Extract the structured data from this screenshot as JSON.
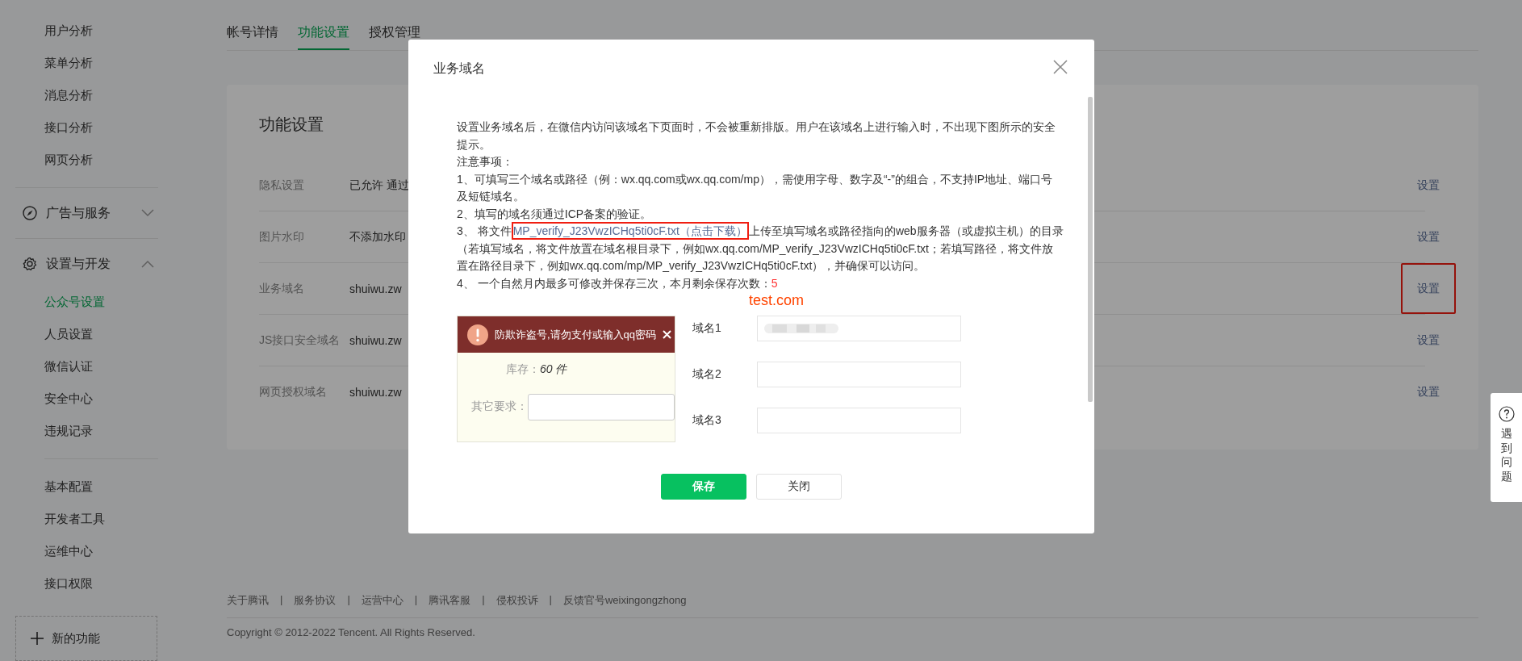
{
  "sidebar": {
    "groups": [
      {
        "kind": "plain",
        "items": [
          {
            "label": "用户分析",
            "selected": false
          },
          {
            "label": "菜单分析",
            "selected": false
          },
          {
            "label": "消息分析",
            "selected": false
          },
          {
            "label": "接口分析",
            "selected": false
          },
          {
            "label": "网页分析",
            "selected": false
          }
        ]
      },
      {
        "kind": "section",
        "label": "广告与服务",
        "expanded": false
      },
      {
        "kind": "section",
        "label": "设置与开发",
        "expanded": true,
        "items": [
          {
            "label": "公众号设置",
            "selected": true
          },
          {
            "label": "人员设置",
            "selected": false
          },
          {
            "label": "微信认证",
            "selected": false
          },
          {
            "label": "安全中心",
            "selected": false
          },
          {
            "label": "违规记录",
            "selected": false
          }
        ]
      },
      {
        "kind": "plain",
        "items": [
          {
            "label": "基本配置",
            "selected": false
          },
          {
            "label": "开发者工具",
            "selected": false
          },
          {
            "label": "运维中心",
            "selected": false
          },
          {
            "label": "接口权限",
            "selected": false
          }
        ]
      }
    ],
    "new_feature": "新的功能"
  },
  "tabs": [
    {
      "label": "帐号详情",
      "selected": false
    },
    {
      "label": "功能设置",
      "selected": true
    },
    {
      "label": "授权管理",
      "selected": false
    }
  ],
  "settings": {
    "title": "功能设置",
    "rows": [
      {
        "label": "隐私设置",
        "value": "已允许 通过",
        "action": "设置",
        "annotated": false
      },
      {
        "label": "图片水印",
        "value": "不添加水印",
        "action": "设置",
        "annotated": false
      },
      {
        "label": "业务域名",
        "value": "shuiwu.zw",
        "action": "设置",
        "annotated": true
      },
      {
        "label": "JS接口安全域名",
        "value": "shuiwu.zw",
        "action": "设置",
        "annotated": false
      },
      {
        "label": "网页授权域名",
        "value": "shuiwu.zw",
        "action": "设置",
        "annotated": false
      }
    ]
  },
  "footer": {
    "separator": "|",
    "links": [
      "关于腾讯",
      "服务协议",
      "运营中心",
      "腾讯客服",
      "侵权投诉",
      "反馈官号weixingongzhong"
    ],
    "copyright": "Copyright © 2012-2022 Tencent. All Rights Reserved."
  },
  "help": {
    "label": "遇到问题"
  },
  "dialog": {
    "title": "业务域名",
    "intro": "设置业务域名后，在微信内访问该域名下页面时，不会被重新排版。用户在该域名上进行输入时，不出现下图所示的安全提示。",
    "notes_heading": "注意事项：",
    "notes": [
      {
        "text": "1、可填写三个域名或路径（例：wx.qq.com或wx.qq.com/mp），需使用字母、数字及“-”的组合，不支持IP地址、端口号及短链域名。"
      },
      {
        "text": "2、填写的域名须通过ICP备案的验证。"
      },
      {
        "text": "3、 将文件",
        "link": "MP_verify_J23VwzICHq5ti0cF.txt（点击下载）",
        "link_annotated": true,
        "after": "上传至填写域名或路径指向的web服务器（或虚拟主机）的目录（若填写域名，将文件放置在域名根目录下，例如wx.qq.com/MP_verify_J23VwzICHq5ti0cF.txt；若填写路径，将文件放置在路径目录下，例如wx.qq.com/mp/MP_verify_J23VwzICHq5ti0cF.txt），并确保可以访问。"
      },
      {
        "text": "4、 一个自然月内最多可修改并保存三次，本月剩余保存次数：",
        "count": "5"
      }
    ],
    "example": {
      "banner": "防欺诈盗号,请勿支付或输入qq密码",
      "fields": [
        {
          "kind": "text",
          "label": "库存：",
          "value": "60 件"
        },
        {
          "kind": "input",
          "label": "其它要求："
        }
      ]
    },
    "annotation": "test.com",
    "domains": [
      {
        "label": "域名1",
        "redacted": true
      },
      {
        "label": "域名2",
        "redacted": false
      },
      {
        "label": "域名3",
        "redacted": false
      }
    ],
    "buttons": [
      {
        "label": "保存",
        "kind": "primary"
      },
      {
        "label": "关闭",
        "kind": "default"
      }
    ]
  }
}
